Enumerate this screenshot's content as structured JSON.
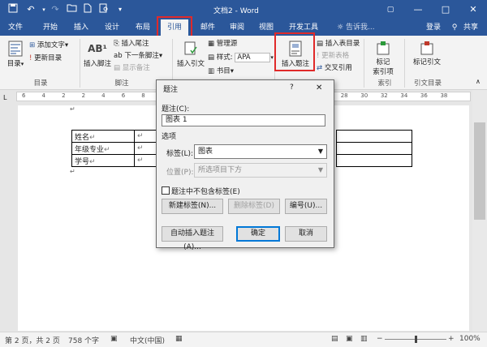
{
  "window": {
    "title": "文档2 - Word",
    "minimize_glyph": "—",
    "maximize_glyph": "□",
    "close_glyph": "✕",
    "options_glyph": "▢"
  },
  "tabs": [
    "文件",
    "开始",
    "插入",
    "设计",
    "布局",
    "引用",
    "邮件",
    "审阅",
    "视图",
    "开发工具"
  ],
  "active_tab": "引用",
  "tell_me": "告诉我...",
  "account": {
    "login": "登录",
    "share": "共享"
  },
  "ribbon": {
    "toc": {
      "label": "目录",
      "add_text": "添加文字",
      "update_toc": "更新目录",
      "group": "目录"
    },
    "footnotes": {
      "insert_footnote": "插入脚注",
      "insert_endnote": "插入尾注",
      "next_footnote": "下一条脚注",
      "show_notes": "显示备注",
      "group": "脚注",
      "ab_glyph": "AB¹"
    },
    "citations": {
      "insert_citation": "插入引文",
      "manage_sources": "管理源",
      "style_label": "样式:",
      "style_value": "APA",
      "bibliography": "书目"
    },
    "captions": {
      "insert_caption": "插入题注",
      "insert_table_of_figures": "插入表目录",
      "update_table": "更新表格",
      "cross_reference": "交叉引用"
    },
    "index": {
      "mark_entry": "标记\n索引项",
      "group": "索引"
    },
    "authorities": {
      "mark_citation": "标记引文",
      "group": "引文目录"
    }
  },
  "ruler_numbers": [
    "6",
    "4",
    "2",
    "2",
    "4",
    "6",
    "8",
    "10",
    "12",
    "14",
    "16",
    "18",
    "20",
    "22",
    "24",
    "26",
    "28",
    "30",
    "32",
    "34",
    "36",
    "38"
  ],
  "document": {
    "table_rows": [
      {
        "label": "姓名",
        "mark": "↵"
      },
      {
        "label": "年级专业",
        "mark": "↵"
      },
      {
        "label": "学号",
        "mark": "↵"
      }
    ],
    "para_mark": "↵"
  },
  "dialog": {
    "title": "题注",
    "help": "?",
    "close": "✕",
    "caption_label": "题注(C):",
    "caption_value": "图表 1",
    "options_label": "选项",
    "label_label": "标签(L):",
    "label_value": "图表",
    "position_label": "位置(P):",
    "position_value": "所选项目下方",
    "exclude_label_checkbox": "题注中不包含标签(E)",
    "exclude_checked": false,
    "new_label_button": "新建标签(N)...",
    "delete_label_button": "删除标签(D)",
    "numbering_button": "编号(U)...",
    "autocaption_button": "自动插入题注(A)...",
    "ok_button": "确定",
    "cancel_button": "取消"
  },
  "status": {
    "page": "第 2 页，共 2 页",
    "words": "758 个字",
    "language": "中文(中国)",
    "zoom": "100%",
    "zoom_minus": "−",
    "zoom_plus": "+",
    "zoom_fraction": 0.5
  },
  "colors": {
    "brand": "#2b579a",
    "highlight": "#e02a2a"
  }
}
